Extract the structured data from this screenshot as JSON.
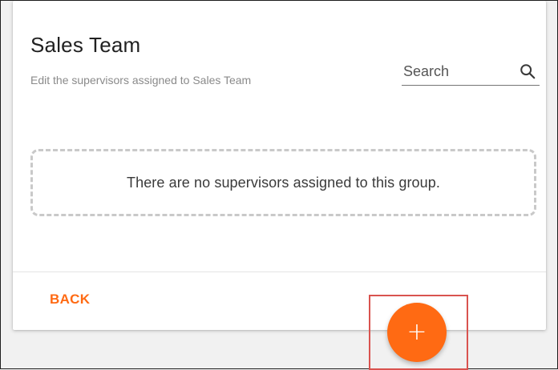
{
  "card": {
    "title": "Sales Team",
    "subtitle": "Edit the supervisors assigned to Sales Team"
  },
  "search": {
    "placeholder": "Search",
    "icon": "search-icon"
  },
  "empty_state": {
    "message": "There are no supervisors assigned to this group."
  },
  "actions": {
    "back_label": "BACK",
    "add_label": "+"
  },
  "colors": {
    "accent": "#ff6a13",
    "highlight": "#d9534f",
    "title": "#212121",
    "subtitle": "#8a8a8a"
  }
}
